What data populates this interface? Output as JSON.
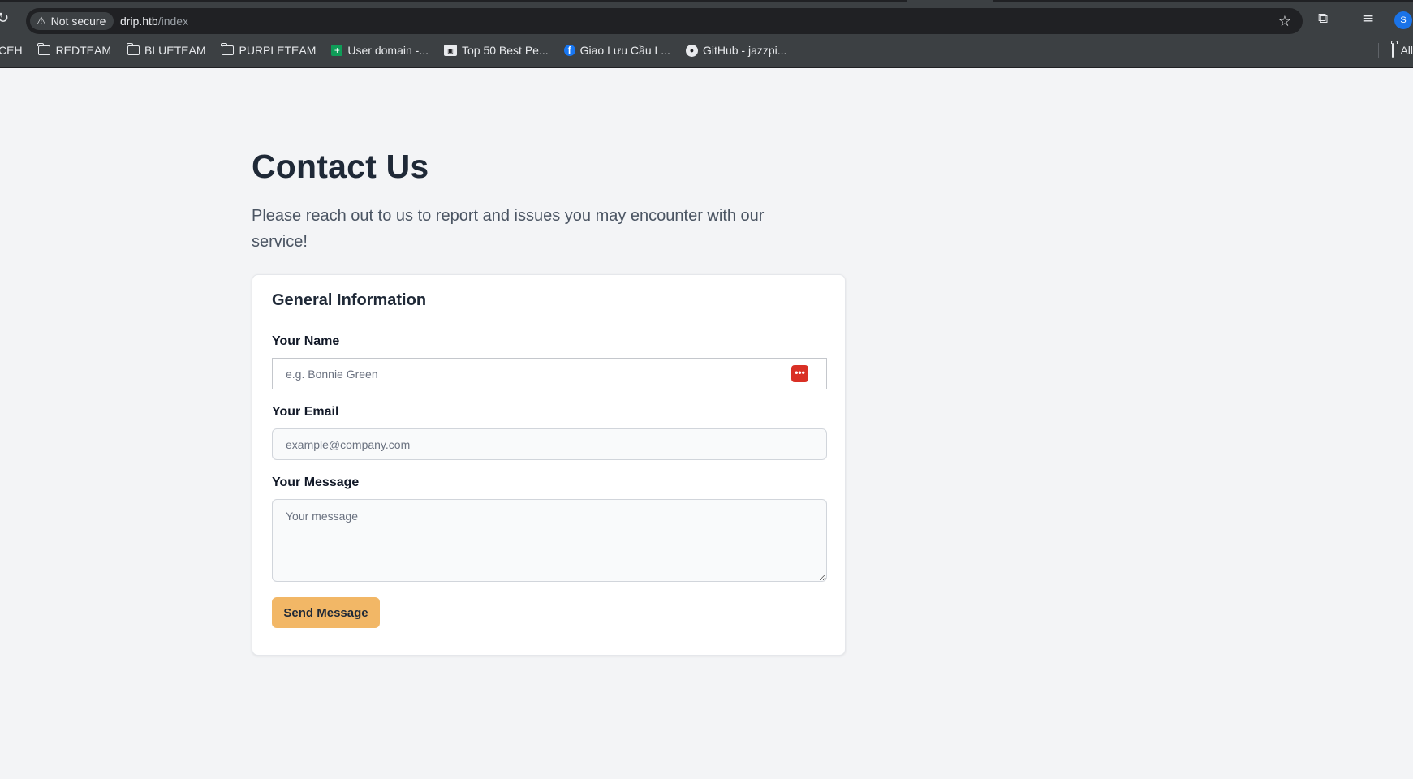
{
  "browser": {
    "security_label": "Not secure",
    "url_host": "drip.htb",
    "url_path": "/index",
    "profile_initial": "S",
    "bookmarks": [
      {
        "label": "CEH",
        "icon": "folder-icon"
      },
      {
        "label": "REDTEAM",
        "icon": "folder-icon"
      },
      {
        "label": "BLUETEAM",
        "icon": "folder-icon"
      },
      {
        "label": "PURPLETEAM",
        "icon": "folder-icon"
      },
      {
        "label": "User domain -...",
        "icon": "sheets-icon"
      },
      {
        "label": "Top 50 Best Pe...",
        "icon": "site-icon"
      },
      {
        "label": "Giao Lưu Cầu L...",
        "icon": "facebook-icon"
      },
      {
        "label": "GitHub - jazzpi...",
        "icon": "github-icon"
      }
    ],
    "all_bookmarks_label": "All"
  },
  "page": {
    "title": "Contact Us",
    "subtitle": "Please reach out to us to report and issues you may encounter with our service!",
    "form": {
      "heading": "General Information",
      "name_label": "Your Name",
      "name_placeholder": "e.g. Bonnie Green",
      "email_label": "Your Email",
      "email_placeholder": "example@company.com",
      "message_label": "Your Message",
      "message_placeholder": "Your message",
      "submit_label": "Send Message"
    }
  },
  "colors": {
    "accent": "#f2b766",
    "page_bg": "#f3f4f6",
    "heading": "#1f2937"
  }
}
